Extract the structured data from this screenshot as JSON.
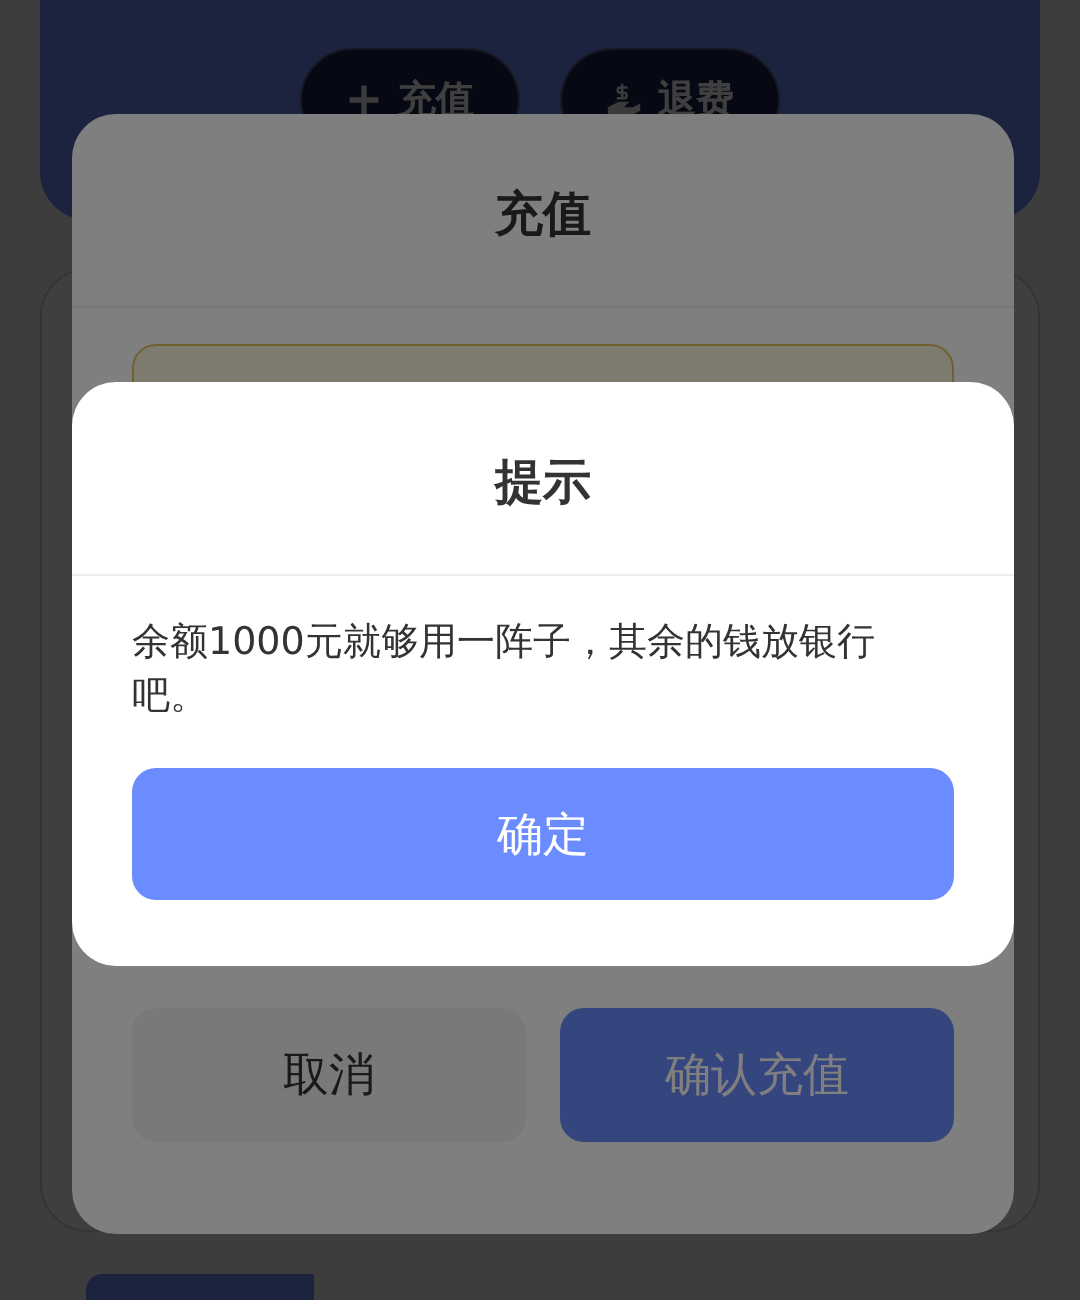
{
  "page": {
    "actions": [
      {
        "kind": "add",
        "label": "充值"
      },
      {
        "kind": "refund",
        "label": "退费"
      }
    ]
  },
  "recharge_dialog": {
    "title": "充值",
    "buttons": [
      {
        "label": "取消",
        "kind": "secondary"
      },
      {
        "label": "确认充值",
        "kind": "primary"
      }
    ]
  },
  "alert": {
    "title": "提示",
    "message": "余额1000元就够用一阵子，其余的钱放银行吧。",
    "button": "确定"
  }
}
